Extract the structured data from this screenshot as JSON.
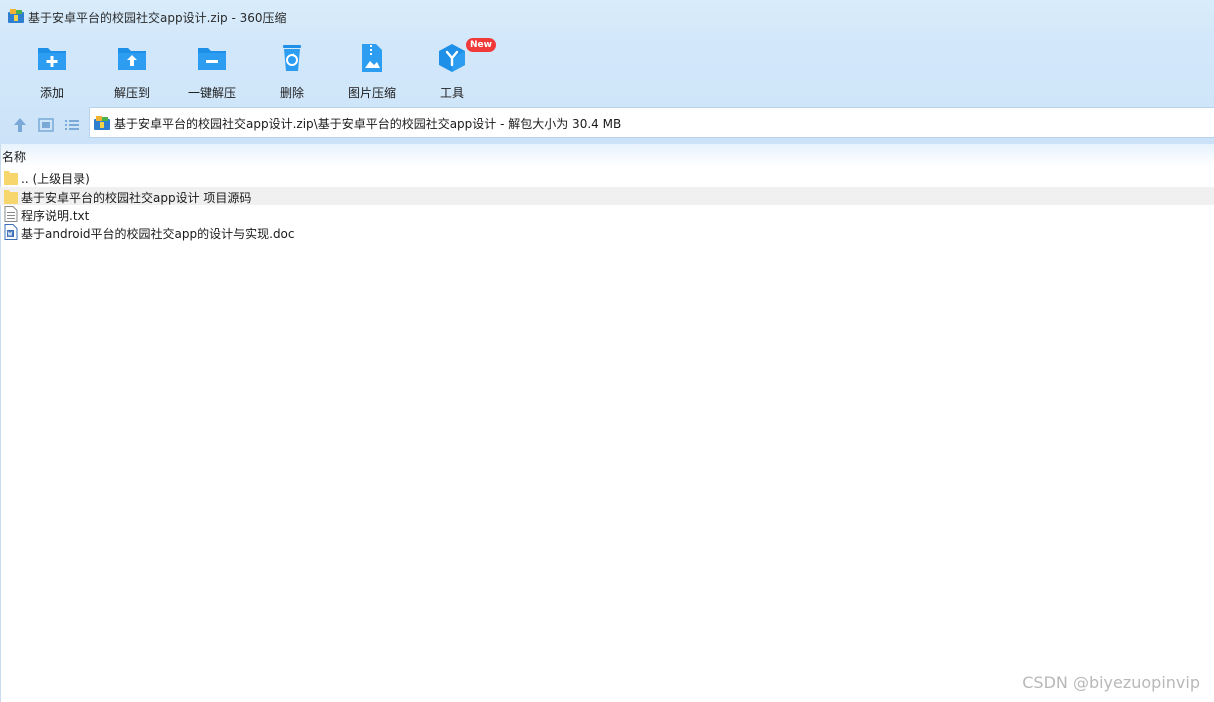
{
  "window": {
    "title": "基于安卓平台的校园社交app设计.zip - 360压缩"
  },
  "toolbar": {
    "items": [
      {
        "label": "添加",
        "icon": "add-folder-icon"
      },
      {
        "label": "解压到",
        "icon": "extract-to-icon"
      },
      {
        "label": "一键解压",
        "icon": "one-click-extract-icon"
      },
      {
        "label": "删除",
        "icon": "recycle-bin-icon"
      },
      {
        "label": "图片压缩",
        "icon": "image-compress-icon"
      },
      {
        "label": "工具",
        "icon": "tools-cube-icon",
        "badge": "New"
      }
    ]
  },
  "address": {
    "path": "基于安卓平台的校园社交app设计.zip\\基于安卓平台的校园社交app设计 - 解包大小为 30.4 MB"
  },
  "list": {
    "column_header": "名称",
    "rows": [
      {
        "name": ".. (上级目录)",
        "type": "folder"
      },
      {
        "name": "基于安卓平台的校园社交app设计 项目源码",
        "type": "folder",
        "selected": true
      },
      {
        "name": "程序说明.txt",
        "type": "text"
      },
      {
        "name": "基于android平台的校园社交app的设计与实现.doc",
        "type": "doc"
      }
    ]
  },
  "watermark": "CSDN @biyezuopinvip",
  "colors": {
    "accent": "#1e90e8",
    "toolbar_bg": "#d3e8fa",
    "badge": "#f03a3a",
    "folder": "#f7d66d"
  }
}
